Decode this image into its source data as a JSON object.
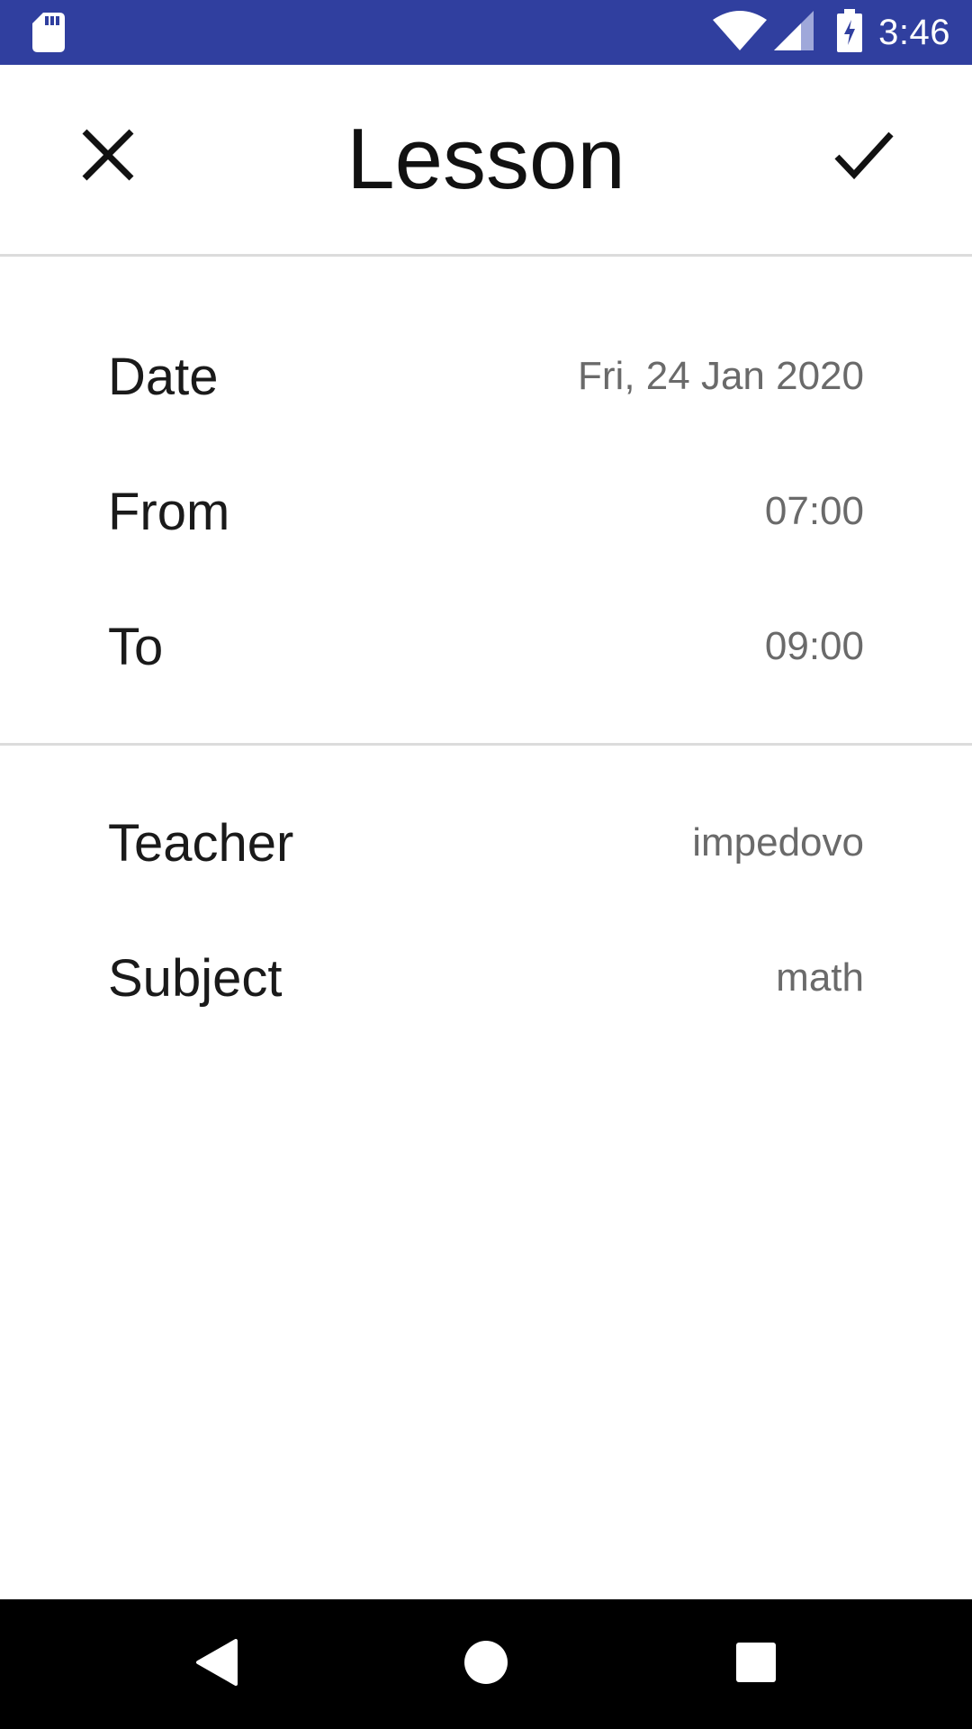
{
  "status_bar": {
    "time": "3:46",
    "background_color": "#303f9f",
    "icons": [
      "sd-card-icon",
      "wifi-icon",
      "cell-signal-icon",
      "battery-charging-icon"
    ]
  },
  "toolbar": {
    "title": "Lesson",
    "close_icon": "close-icon",
    "confirm_icon": "check-icon"
  },
  "form": {
    "schedule": [
      {
        "label": "Date",
        "value": "Fri, 24 Jan 2020"
      },
      {
        "label": "From",
        "value": "07:00"
      },
      {
        "label": "To",
        "value": "09:00"
      }
    ],
    "details": [
      {
        "label": "Teacher",
        "value": "impedovo"
      },
      {
        "label": "Subject",
        "value": "math"
      }
    ]
  },
  "nav_bar": {
    "icons": [
      "back-icon",
      "home-icon",
      "recents-icon"
    ]
  }
}
